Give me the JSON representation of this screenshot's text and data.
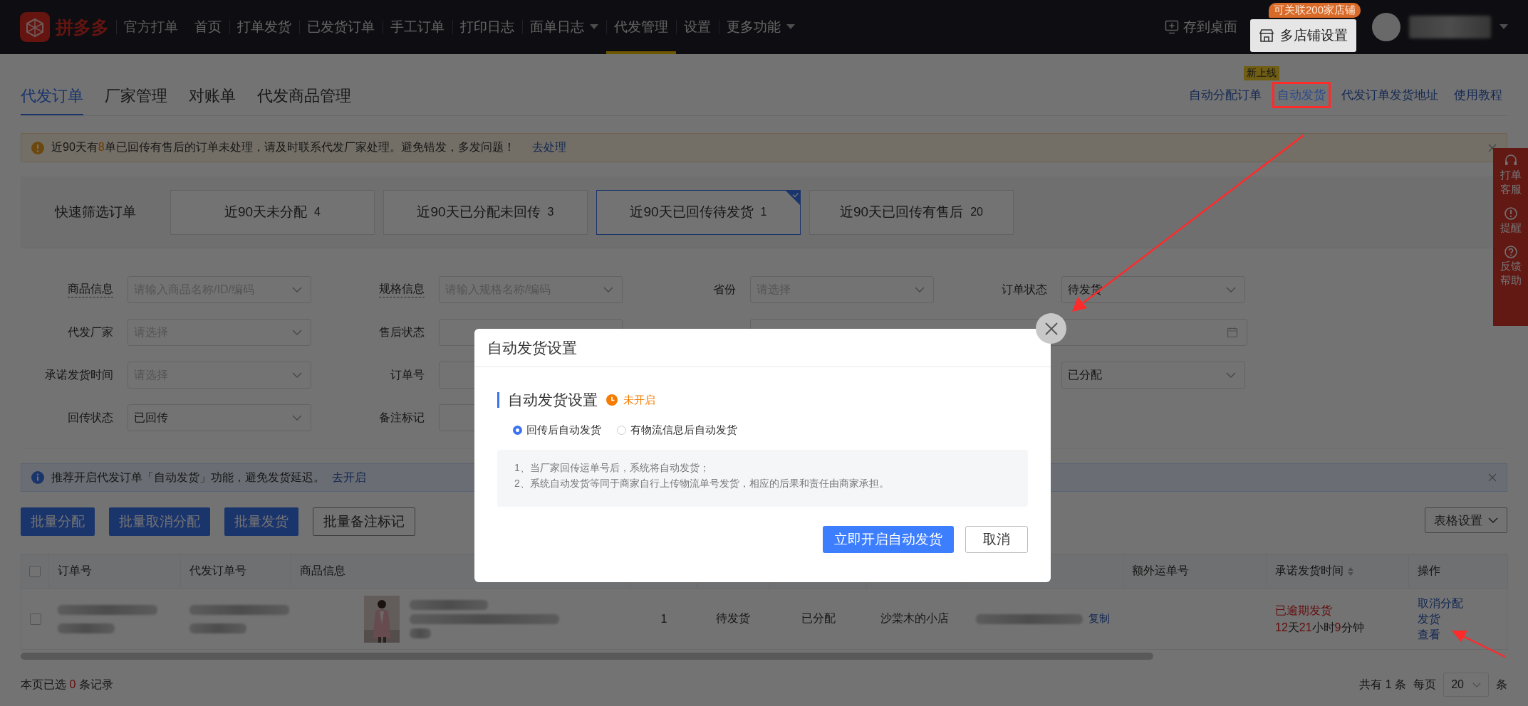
{
  "header": {
    "brand": "拼多多",
    "product": "官方打单",
    "nav": [
      {
        "label": "首页",
        "selected": false,
        "dropdown": false
      },
      {
        "label": "打单发货",
        "selected": false,
        "dropdown": false
      },
      {
        "label": "已发货订单",
        "selected": false,
        "dropdown": false
      },
      {
        "label": "手工订单",
        "selected": false,
        "dropdown": false
      },
      {
        "label": "打印日志",
        "selected": false,
        "dropdown": false
      },
      {
        "label": "面单日志",
        "selected": false,
        "dropdown": true
      },
      {
        "label": "代发管理",
        "selected": true,
        "dropdown": false
      },
      {
        "label": "设置",
        "selected": false,
        "dropdown": false
      },
      {
        "label": "更多功能",
        "selected": false,
        "dropdown": true
      }
    ],
    "save_desktop": "存到桌面",
    "multi_store": "多店铺设置",
    "multi_store_badge": "可关联200家店铺"
  },
  "subnav": {
    "tabs": [
      {
        "label": "代发订单",
        "selected": true
      },
      {
        "label": "厂家管理",
        "selected": false
      },
      {
        "label": "对账单",
        "selected": false
      },
      {
        "label": "代发商品管理",
        "selected": false
      }
    ],
    "links": [
      {
        "label": "自动分配订单",
        "highlighted": false
      },
      {
        "label": "自动发货",
        "badge": "新上线",
        "highlighted": true
      },
      {
        "label": "代发订单发货地址",
        "highlighted": false
      },
      {
        "label": "使用教程",
        "highlighted": false
      }
    ]
  },
  "alert": {
    "parts": [
      {
        "text": "近90天有",
        "emph": false
      },
      {
        "text": "8",
        "emph": true
      },
      {
        "text": "单已回传有售后的订单未处理，请及时联系代发厂家处理。避免错发，多发问题！",
        "emph": false
      }
    ],
    "link": "去处理"
  },
  "quick_filter": {
    "label": "快速筛选订单",
    "chips": [
      {
        "label": "近90天未分配",
        "count": "4",
        "selected": false
      },
      {
        "label": "近90天已分配未回传",
        "count": "3",
        "selected": false
      },
      {
        "label": "近90天已回传待发货",
        "count": "1",
        "selected": true
      },
      {
        "label": "近90天已回传有售后",
        "count": "20",
        "selected": false
      }
    ]
  },
  "filters": [
    {
      "label": "商品信息",
      "underline": true,
      "placeholder": "请输入商品名称/ID/编码",
      "kind": "select"
    },
    {
      "label": "规格信息",
      "underline": true,
      "placeholder": "请输入规格名称/编码",
      "kind": "select"
    },
    {
      "label": "省份",
      "placeholder": "请选择",
      "kind": "select"
    },
    {
      "label": "订单状态",
      "value": "待发货",
      "kind": "select"
    },
    {
      "label": "代发厂家",
      "placeholder": "请选择",
      "kind": "select"
    },
    {
      "label": "售后状态",
      "kind": "select"
    },
    {
      "kind": "date"
    },
    {
      "label": "承诺发货时间",
      "placeholder": "请选择",
      "kind": "select"
    },
    {
      "label": "订单号",
      "kind": "input"
    },
    {
      "kind": "blank"
    },
    {
      "value": "已分配",
      "kind": "select"
    },
    {
      "label": "回传状态",
      "value": "已回传",
      "kind": "select"
    },
    {
      "label": "备注标记",
      "kind": "select"
    }
  ],
  "info": {
    "text": "推荐开启代发订单「自动发货」功能，避免发货延迟。",
    "link": "去开启"
  },
  "actions": {
    "buttons": [
      {
        "label": "批量分配",
        "kind": "primary"
      },
      {
        "label": "批量取消分配",
        "kind": "primary"
      },
      {
        "label": "批量发货",
        "kind": "primary"
      },
      {
        "label": "批量备注标记",
        "kind": "default"
      }
    ],
    "table_settings": "表格设置"
  },
  "table": {
    "columns": [
      {
        "kind": "checkbox",
        "checked": false
      },
      {
        "label": "订单号",
        "kind": "text"
      },
      {
        "label": "代发订单号",
        "kind": "text"
      },
      {
        "label": "商品信息",
        "kind": "text"
      },
      {
        "kind": "text"
      },
      {
        "kind": "text"
      },
      {
        "kind": "text"
      },
      {
        "kind": "text"
      },
      {
        "kind": "text"
      },
      {
        "label": "额外运单号",
        "kind": "text"
      },
      {
        "label": "承诺发货时间",
        "kind": "sortable"
      },
      {
        "label": "操作",
        "kind": "text"
      }
    ],
    "rows": [
      {
        "cells": [
          {
            "kind": "checkbox",
            "checked": false
          },
          {
            "kind": "redacted"
          },
          {
            "kind": "redacted"
          },
          {
            "kind": "product"
          },
          {
            "kind": "text",
            "text": "1"
          },
          {
            "kind": "text",
            "text": "待发货"
          },
          {
            "kind": "text",
            "text": "已分配"
          },
          {
            "kind": "text",
            "text": "沙棠木的小店"
          },
          {
            "kind": "tracking",
            "link": "复制"
          },
          {
            "kind": "empty"
          },
          {
            "kind": "deadline",
            "status": "已逾期发货",
            "parts": [
              {
                "text": "12",
                "emph": true
              },
              {
                "text": "天",
                "emph": false
              },
              {
                "text": "21",
                "emph": true
              },
              {
                "text": "小时",
                "emph": false
              },
              {
                "text": "9",
                "emph": true
              },
              {
                "text": "分钟",
                "emph": false
              }
            ]
          },
          {
            "kind": "actions",
            "links": [
              "取消分配",
              "发货",
              "查看"
            ]
          }
        ]
      }
    ]
  },
  "footer": {
    "parts": [
      {
        "text": "本页已选 ",
        "emph": false
      },
      {
        "text": "0",
        "emph": true
      },
      {
        "text": " 条记录",
        "emph": false
      }
    ],
    "total": "共有 1 条",
    "per_page": "每页",
    "page_size": "20",
    "unit": "条"
  },
  "side_tools": [
    {
      "label": "打单客服",
      "kind": "headset"
    },
    {
      "label": "提醒",
      "kind": "alert"
    },
    {
      "label": "反馈帮助",
      "kind": "help"
    }
  ],
  "modal": {
    "title": "自动发货设置",
    "section": "自动发货设置",
    "status": "未开启",
    "enabled": false,
    "options": [
      {
        "label": "回传后自动发货",
        "selected": true
      },
      {
        "label": "有物流信息后自动发货",
        "selected": false
      }
    ],
    "notes": [
      "1、当厂家回传运单号后，系统将自动发货；",
      "2、系统自动发货等同于商家自行上传物流单号发货，相应的后果和责任由商家承担。"
    ],
    "confirm": "立即开启自动发货",
    "cancel": "取消"
  }
}
